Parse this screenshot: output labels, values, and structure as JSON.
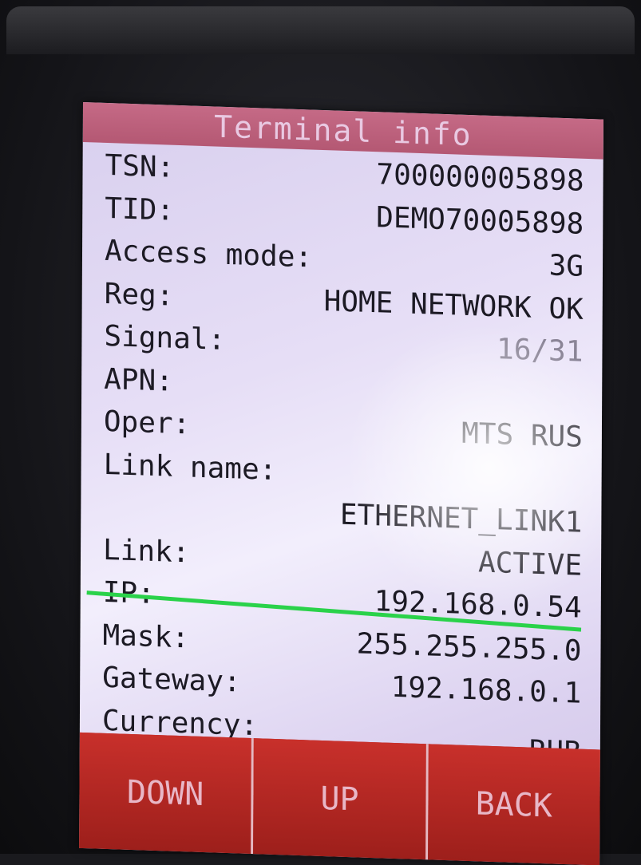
{
  "screen": {
    "title": "Terminal info"
  },
  "rows": [
    {
      "label": "TSN:",
      "value": "700000005898"
    },
    {
      "label": "TID:",
      "value": "DEMO70005898"
    },
    {
      "label": "Access mode:",
      "value": "3G"
    },
    {
      "label": "Reg:",
      "value": "HOME NETWORK OK"
    },
    {
      "label": "Signal:",
      "value": "16/31"
    },
    {
      "label": "APN:",
      "value": ""
    },
    {
      "label": "Oper:",
      "value": "MTS RUS"
    },
    {
      "label": "Link name:",
      "value": ""
    },
    {
      "label": "",
      "value": "ETHERNET_LINK1"
    },
    {
      "label": "Link:",
      "value": "ACTIVE"
    },
    {
      "label": "IP:",
      "value": "192.168.0.54"
    },
    {
      "label": "Mask:",
      "value": "255.255.255.0"
    },
    {
      "label": "Gateway:",
      "value": "192.168.0.1"
    },
    {
      "label": "Currency:",
      "value": "RUB"
    }
  ],
  "softkeys": {
    "down": "DOWN",
    "up": "UP",
    "back": "BACK"
  },
  "colors": {
    "title_bar": "#b45873",
    "screen_bg": "#e6def6",
    "softkey_bg": "#a9231f",
    "divider": "#2ad24a"
  }
}
